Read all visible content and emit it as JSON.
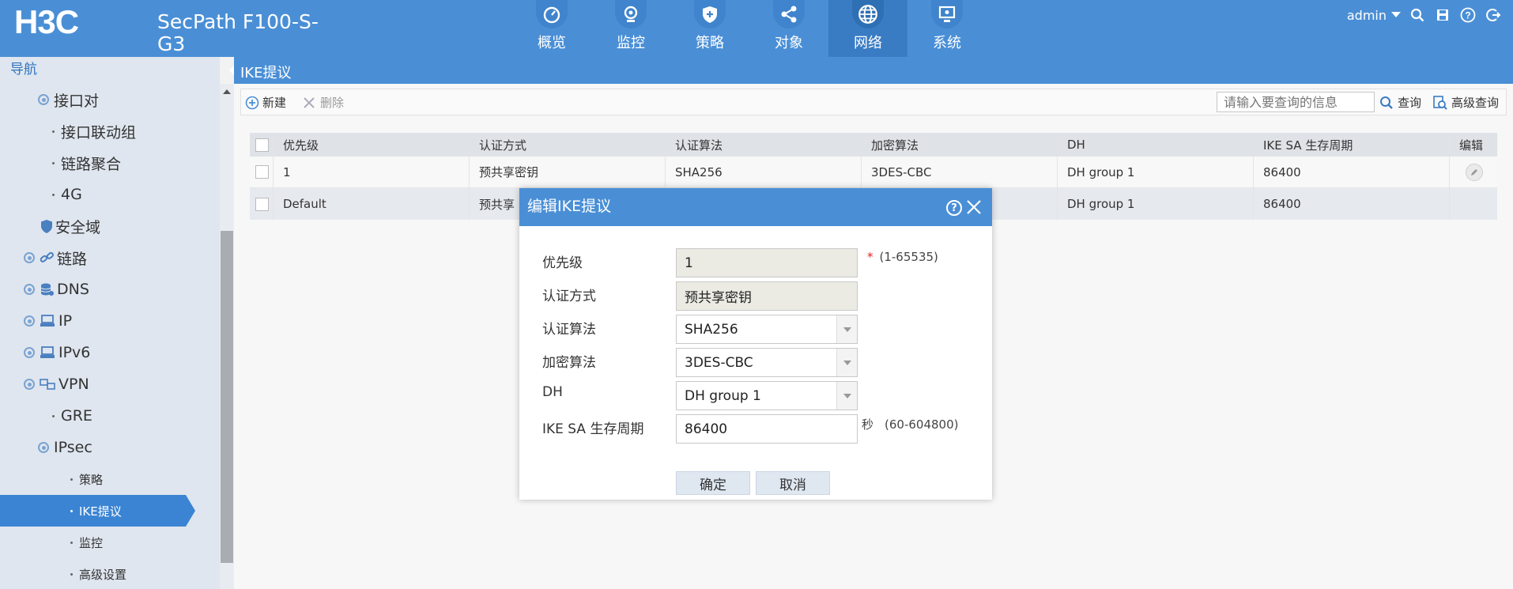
{
  "header": {
    "brand": "H3C",
    "product": "SecPath F100-S-G3",
    "tabs": [
      {
        "label": "概览",
        "icon": "dashboard-icon"
      },
      {
        "label": "监控",
        "icon": "monitor-icon"
      },
      {
        "label": "策略",
        "icon": "shield-icon"
      },
      {
        "label": "对象",
        "icon": "share-icon"
      },
      {
        "label": "网络",
        "icon": "globe-icon",
        "active": true
      },
      {
        "label": "系统",
        "icon": "system-icon"
      }
    ],
    "user": "admin"
  },
  "sidebar": {
    "title": "导航",
    "items": [
      {
        "label": "接口对",
        "level": 2
      },
      {
        "label": "接口联动组",
        "level": 3
      },
      {
        "label": "链路聚合",
        "level": 3
      },
      {
        "label": "4G",
        "level": 3
      },
      {
        "label": "安全域",
        "level": 2
      },
      {
        "label": "链路",
        "level": 1
      },
      {
        "label": "DNS",
        "level": 1
      },
      {
        "label": "IP",
        "level": 1
      },
      {
        "label": "IPv6",
        "level": 1
      },
      {
        "label": "VPN",
        "level": 1
      },
      {
        "label": "GRE",
        "level": 3
      },
      {
        "label": "IPsec",
        "level": 2
      },
      {
        "label": "策略",
        "level": 4
      },
      {
        "label": "IKE提议",
        "level": 4,
        "active": true
      },
      {
        "label": "监控",
        "level": 4
      },
      {
        "label": "高级设置",
        "level": 4
      }
    ]
  },
  "main": {
    "breadcrumb": "IKE提议",
    "toolbar": {
      "new_label": "新建",
      "delete_label": "删除",
      "search_placeholder": "请输入要查询的信息",
      "query_label": "查询",
      "advanced_label": "高级查询"
    },
    "table": {
      "columns": [
        "优先级",
        "认证方式",
        "认证算法",
        "加密算法",
        "DH",
        "IKE SA 生存周期",
        "编辑"
      ],
      "rows": [
        [
          "1",
          "预共享密钥",
          "SHA256",
          "3DES-CBC",
          "DH group 1",
          "86400"
        ],
        [
          "Default",
          "预共享",
          "",
          "",
          "DH group 1",
          "86400"
        ]
      ]
    }
  },
  "dialog": {
    "title": "编辑IKE提议",
    "fields": [
      {
        "label": "优先级",
        "value": "1",
        "hint": "(1-65535)",
        "required": "*"
      },
      {
        "label": "认证方式",
        "value": "预共享密钥"
      },
      {
        "label": "认证算法",
        "value": "SHA256"
      },
      {
        "label": "加密算法",
        "value": "3DES-CBC"
      },
      {
        "label": "DH",
        "value": "DH group 1"
      },
      {
        "label": "IKE SA 生存周期",
        "value": "86400",
        "unit": "秒",
        "hint": "(60-604800)"
      }
    ],
    "ok_label": "确定",
    "cancel_label": "取消"
  }
}
